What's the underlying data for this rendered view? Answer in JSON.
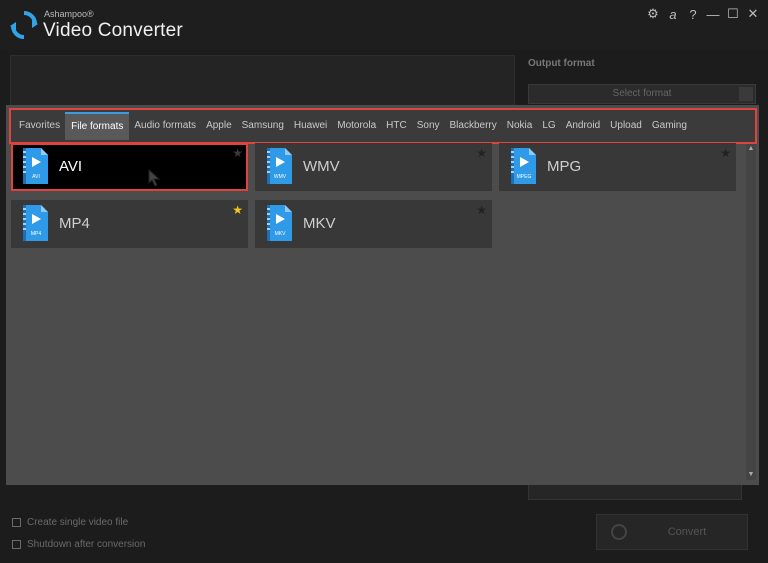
{
  "app": {
    "brand_small": "Ashampoo®",
    "brand_big": "Video Converter",
    "controls": [
      "gear-icon",
      "ashampoo-a-icon",
      "help-icon",
      "minimize-icon",
      "maximize-icon",
      "close-icon"
    ],
    "control_glyphs": [
      "⚙",
      "a",
      "?",
      "—",
      "☐",
      "✕"
    ]
  },
  "background": {
    "output_format_label": "Output format",
    "select_format_label": "Select format",
    "option1": "Create single video file",
    "option2": "Shutdown after conversion",
    "convert_label": "Convert"
  },
  "tabs": [
    {
      "label": "Favorites",
      "active": false
    },
    {
      "label": "File formats",
      "active": true
    },
    {
      "label": "Audio formats",
      "active": false
    },
    {
      "label": "Apple",
      "active": false
    },
    {
      "label": "Samsung",
      "active": false
    },
    {
      "label": "Huawei",
      "active": false
    },
    {
      "label": "Motorola",
      "active": false
    },
    {
      "label": "HTC",
      "active": false
    },
    {
      "label": "Sony",
      "active": false
    },
    {
      "label": "Blackberry",
      "active": false
    },
    {
      "label": "Nokia",
      "active": false
    },
    {
      "label": "LG",
      "active": false
    },
    {
      "label": "Android",
      "active": false
    },
    {
      "label": "Upload",
      "active": false
    },
    {
      "label": "Gaming",
      "active": false
    }
  ],
  "formats": [
    {
      "name": "AVI",
      "icon_label": "AVI",
      "favorite": false,
      "selected": true
    },
    {
      "name": "WMV",
      "icon_label": "WMV",
      "favorite": false,
      "selected": false
    },
    {
      "name": "MPG",
      "icon_label": "MPEG",
      "favorite": false,
      "selected": false
    },
    {
      "name": "MP4",
      "icon_label": "MP4",
      "favorite": true,
      "selected": false
    },
    {
      "name": "MKV",
      "icon_label": "MKV",
      "favorite": false,
      "selected": false
    }
  ],
  "colors": {
    "accent": "#3c9be4",
    "highlight": "#e0433e",
    "favorite_star": "#f5c518",
    "icon_blue": "#2f9ae8"
  }
}
